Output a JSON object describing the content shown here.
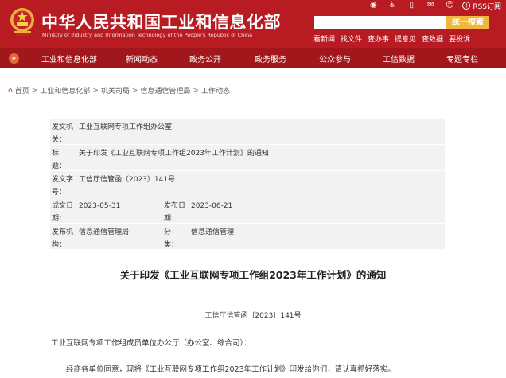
{
  "header": {
    "title": "中华人民共和国工业和信息化部",
    "subtitle": "Ministry of Industry and Information Technology of the People's Republic of China",
    "util_icons": [
      "weibo-icon",
      "accessibility-icon",
      "mobile-icon",
      "mail-icon",
      "user-icon"
    ],
    "rss_label": "RSS订阅",
    "search": {
      "placeholder": "",
      "button_label": "统一搜索"
    },
    "quick_links": [
      "看新闻",
      "找文件",
      "查办事",
      "提意见",
      "查数据",
      "要投诉"
    ]
  },
  "nav": {
    "items": [
      "工业和信息化部",
      "新闻动态",
      "政务公开",
      "政务服务",
      "公众参与",
      "工信数据",
      "专题专栏"
    ]
  },
  "breadcrumb": {
    "items": [
      "首页",
      "工业和信息化部",
      "机关司局",
      "信息通信管理局",
      "工作动态"
    ],
    "separator": ">"
  },
  "meta": {
    "issuer_label": "发文机关：",
    "issuer": "工业互联网专项工作组办公室",
    "title_label": "标　题：",
    "title": "关于印发《工业互联网专项工作组2023年工作计划》的通知",
    "doc_no_label": "发文字号：",
    "doc_no": "工信厅信管函〔2023〕141号",
    "date_label": "成文日期：",
    "date": "2023-05-31",
    "publish_label": "发布日期：",
    "publish_date": "2023-06-21",
    "publisher_label": "发布机构：",
    "publisher": "信息通信管理局",
    "category_label": "分　类：",
    "category": "信息通信管理"
  },
  "article": {
    "title": "关于印发《工业互联网专项工作组2023年工作计划》的通知",
    "doc_number": "工信厅信管函〔2023〕141号",
    "salutation": "工业互联网专项工作组成员单位办公厅（办公室、综合司）：",
    "body": "经商各单位同意，现将《工业互联网专项工作组2023年工作计划》印发给你们，请认真抓好落实。"
  },
  "colors": {
    "header_red": "#b81c22",
    "nav_red": "#a2171c",
    "search_button": "#f0b73f",
    "meta_bg": "#f2f2f2"
  }
}
